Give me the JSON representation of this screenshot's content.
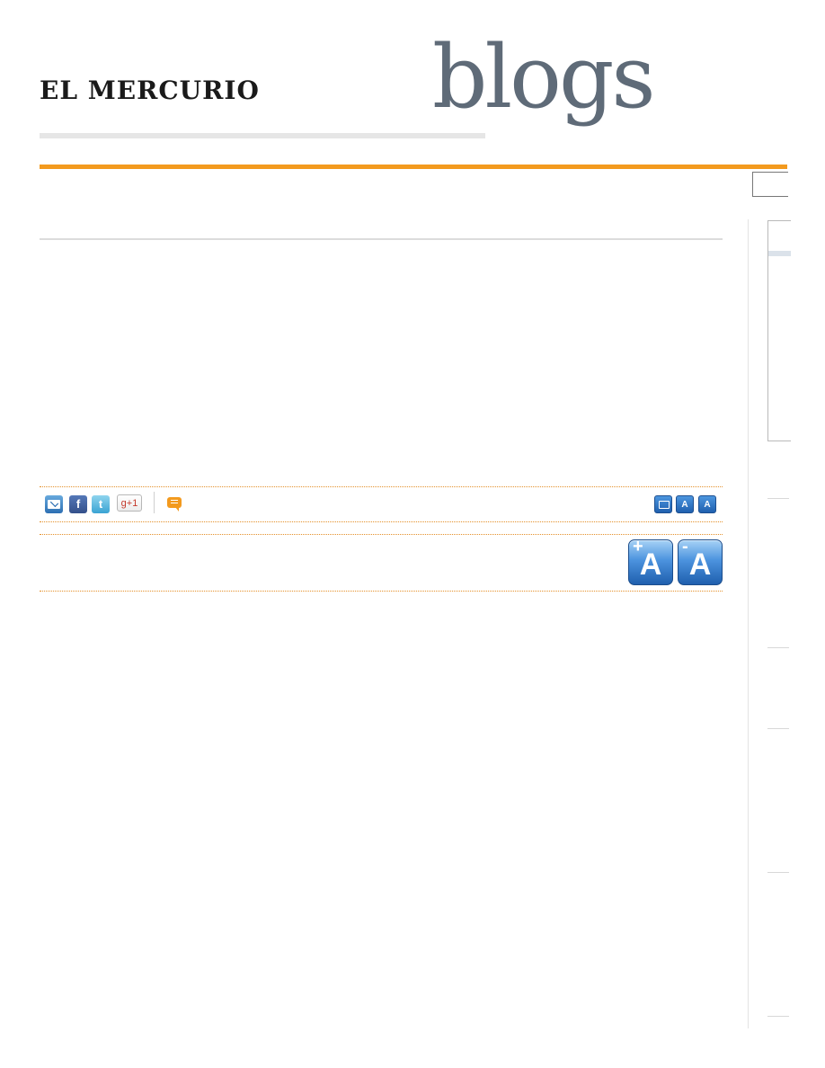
{
  "header": {
    "site_logo": "EL MERCURIO",
    "section_logo": "blogs"
  },
  "share_bar": {
    "email_icon": "email-icon",
    "facebook_icon": "facebook-icon",
    "facebook_glyph": "f",
    "twitter_icon": "twitter-icon",
    "twitter_glyph": "t",
    "gplus_label": "g+1",
    "comment_icon": "comment-icon",
    "print_icon": "print-icon",
    "font_increase_glyph": "A",
    "font_decrease_glyph": "A"
  },
  "font_controls": {
    "increase_sign": "+",
    "increase_letter": "A",
    "decrease_sign": "-",
    "decrease_letter": "A"
  },
  "colors": {
    "accent_orange": "#f39a1e",
    "icon_blue": "#2d6fb3",
    "logo_grey": "#5f6b78"
  }
}
